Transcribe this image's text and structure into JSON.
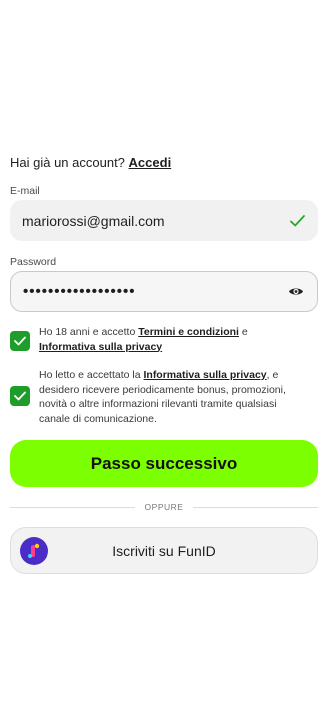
{
  "login": {
    "prompt": "Hai già un account?",
    "link": "Accedi"
  },
  "email": {
    "label": "E-mail",
    "value": "mariorossi@gmail.com",
    "valid_icon": "checkmark-icon"
  },
  "password": {
    "label": "Password",
    "value": "••••••••••••••••••",
    "toggle_icon": "eye-icon"
  },
  "consents": [
    {
      "checked": true,
      "text_prefix": "Ho 18 anni e accetto ",
      "link1": "Termini e condizioni",
      "text_mid": " e ",
      "link2": "Informativa sulla privacy",
      "text_suffix": ""
    },
    {
      "checked": true,
      "text_prefix": "Ho letto e accettato la ",
      "link1": "Informativa sulla privacy",
      "text_suffix": ", e desidero ricevere periodicamente bonus, promozioni, novità o altre informazioni rilevanti tramite qualsiasi canale di comunicazione."
    }
  ],
  "primary_button": {
    "label": "Passo successivo"
  },
  "divider": {
    "label": "OPPURE"
  },
  "funid_button": {
    "label": "Iscriviti su FunID",
    "icon": "funid-logo-icon"
  },
  "colors": {
    "accent_green": "#7cff00",
    "checkbox_green": "#1f9d2a",
    "valid_check": "#2aa52e",
    "funid_purple": "#4b2cc8"
  }
}
